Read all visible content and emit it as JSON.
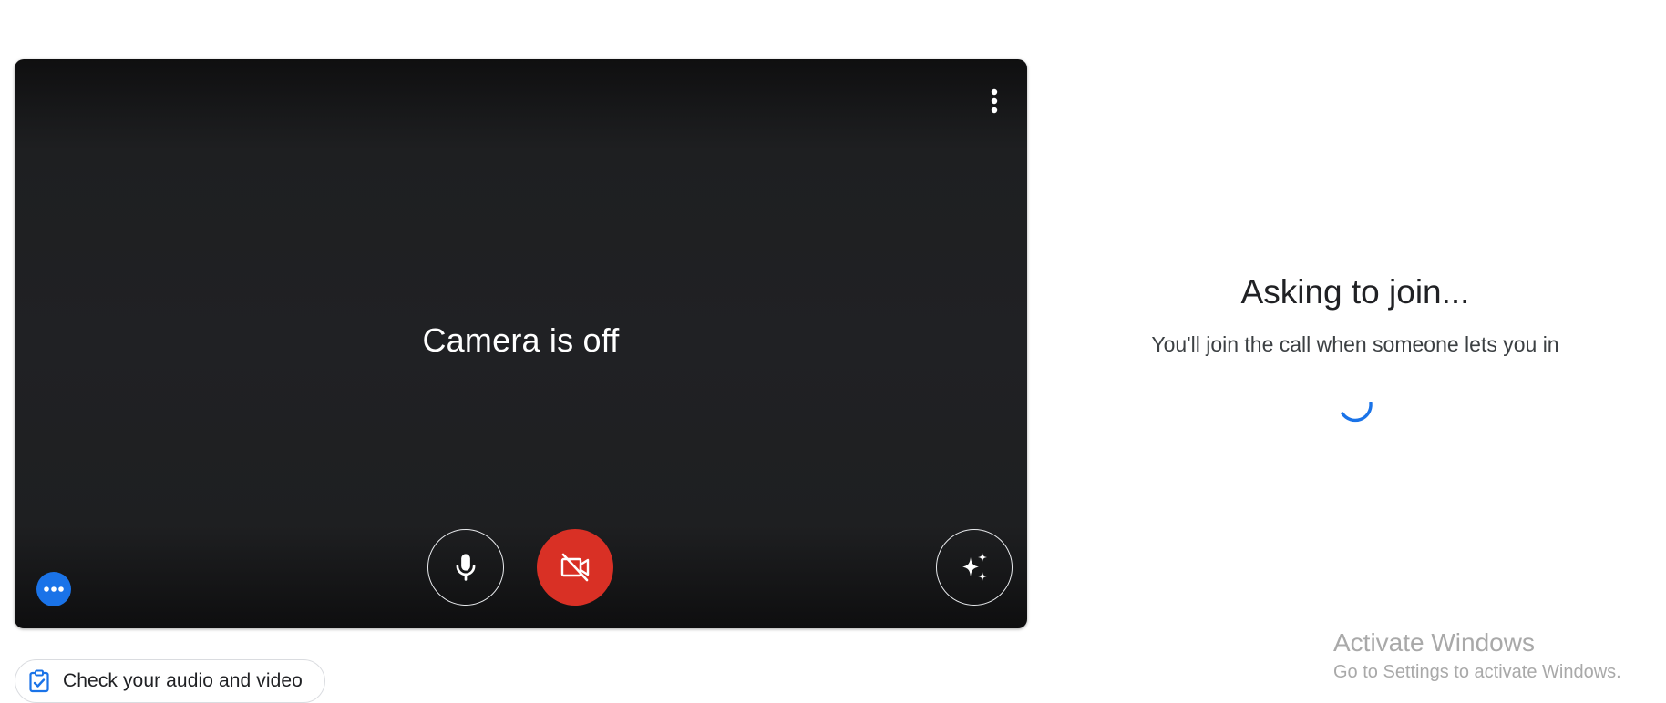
{
  "preview": {
    "camera_status": "Camera is off",
    "more_options_icon": "more-vert-icon",
    "mic_icon": "microphone-icon",
    "camera_icon": "camera-off-icon",
    "effects_icon": "sparkles-icon",
    "dots_icon": "more-horiz-icon",
    "camera_button_color": "#d93025",
    "dots_button_color": "#1a73e8"
  },
  "check_audio_video": {
    "label": "Check your audio and video",
    "icon": "clipboard-check-icon"
  },
  "join_panel": {
    "title": "Asking to join...",
    "subtitle": "You'll join the call when someone lets you in",
    "spinner_color": "#1a73e8"
  },
  "watermark": {
    "title": "Activate Windows",
    "subtitle": "Go to Settings to activate Windows."
  }
}
